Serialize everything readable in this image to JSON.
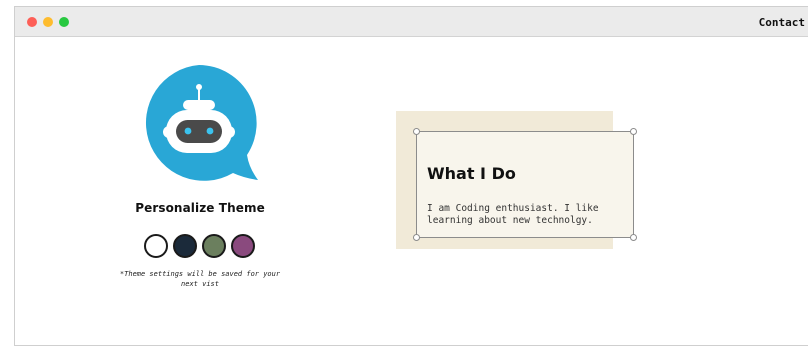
{
  "window": {
    "nav_link": "Contact"
  },
  "profile": {
    "avatar_icon": "robot-chat-bubble-icon",
    "personalize_title": "Personalize Theme",
    "theme_note": "*Theme settings will be saved for your next vist",
    "swatches": [
      {
        "name": "white",
        "color": "#ffffff"
      },
      {
        "name": "navy",
        "color": "#1b2a3a"
      },
      {
        "name": "sage",
        "color": "#6b7f5e"
      },
      {
        "name": "plum",
        "color": "#8a4a7e"
      }
    ]
  },
  "about": {
    "title": "What I Do",
    "text": "I am Coding enthusiast. I like learning about new technolgy."
  },
  "colors": {
    "avatar_blue": "#29a7d6",
    "card_bg": "#f1ead8",
    "card_face": "#f8f5ec"
  }
}
